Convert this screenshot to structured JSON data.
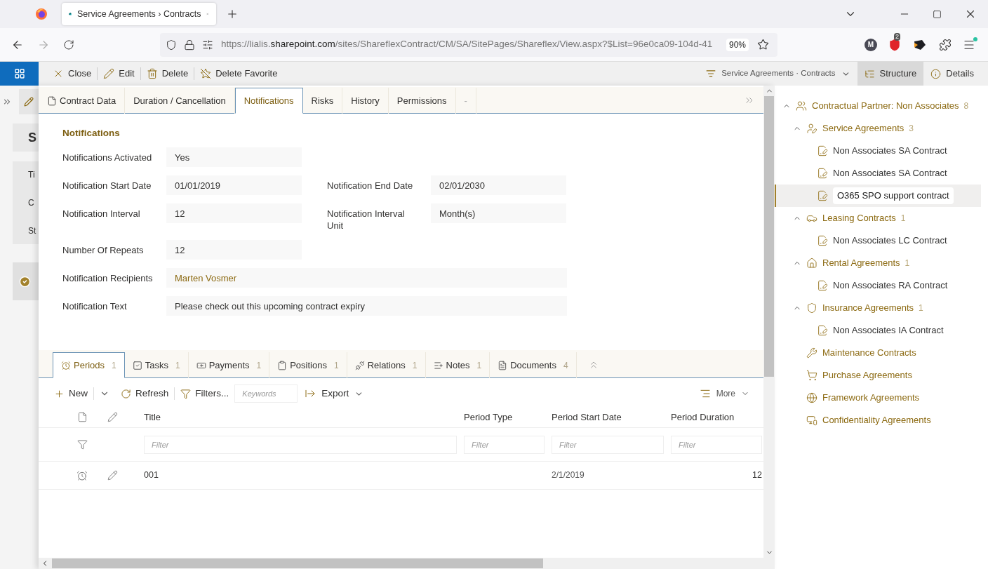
{
  "browser": {
    "tab_title": "Service Agreements › Contracts",
    "url_start": "https://lialis.",
    "url_domain": "sharepoint.com",
    "url_rest": "/sites/ShareflexContract/CM/SA/SitePages/Shareflex/View.aspx?$List=96e0ca09-104d-41",
    "zoom": "90%",
    "profile_initial": "M",
    "blocker_count": "2"
  },
  "background_page": {
    "title": "S",
    "fields": [
      "Ti",
      "C",
      "St"
    ]
  },
  "commands": [
    {
      "label": "Close",
      "kind": "close"
    },
    {
      "label": "Edit",
      "kind": "edit"
    },
    {
      "label": "Delete",
      "kind": "delete"
    },
    {
      "label": "Delete Favorite",
      "kind": "unfavorite"
    }
  ],
  "view_selector": "Service Agreements · Contracts",
  "panes": [
    {
      "label": "Structure",
      "kind": "structure",
      "selected": true
    },
    {
      "label": "Details",
      "kind": "info",
      "selected": false
    }
  ],
  "tabs": [
    {
      "label": "Contract Data",
      "kind": "document",
      "selected": false
    },
    {
      "label": "Duration / Cancellation",
      "selected": false
    },
    {
      "label": "Notifications",
      "selected": true
    },
    {
      "label": "Risks",
      "selected": false
    },
    {
      "label": "History",
      "selected": false
    },
    {
      "label": "Permissions",
      "selected": false
    },
    {
      "label": "-",
      "selected": false
    }
  ],
  "section": {
    "title": "Notifications",
    "rows": [
      {
        "fields": [
          {
            "label": "Notifications Activated",
            "value": "Yes",
            "kind": "text"
          }
        ]
      },
      {
        "fields": [
          {
            "label": "Notification Start Date",
            "value": "01/01/2019",
            "kind": "text"
          },
          {
            "label": "Notification End Date",
            "value": "02/01/2030",
            "kind": "text"
          }
        ]
      },
      {
        "fields": [
          {
            "label": "Notification Interval",
            "value": "12",
            "kind": "text"
          },
          {
            "label": "Notification Interval Unit",
            "value": "Month(s)",
            "kind": "text"
          }
        ]
      },
      {
        "fields": [
          {
            "label": "Number Of Repeats",
            "value": "12",
            "kind": "text"
          }
        ]
      },
      {
        "fields": [
          {
            "label": "Notification Recipients",
            "value": "Marten Vosmer",
            "kind": "person"
          }
        ]
      },
      {
        "fields": [
          {
            "label": "Notification Text",
            "value": "Please check out this upcoming contract expiry",
            "kind": "long"
          }
        ]
      }
    ]
  },
  "subtabs": [
    {
      "label": "Periods",
      "count": "1",
      "kind": "alarm",
      "selected": true
    },
    {
      "label": "Tasks",
      "count": "1",
      "kind": "task",
      "selected": false
    },
    {
      "label": "Payments",
      "count": "1",
      "kind": "money",
      "selected": false
    },
    {
      "label": "Positions",
      "count": "1",
      "kind": "clipboard",
      "selected": false
    },
    {
      "label": "Relations",
      "count": "1",
      "kind": "plug",
      "selected": false
    },
    {
      "label": "Notes",
      "count": "1",
      "kind": "notes",
      "selected": false
    },
    {
      "label": "Documents",
      "count": "4",
      "kind": "document",
      "selected": false
    }
  ],
  "toolbar": {
    "new": "New",
    "refresh": "Refresh",
    "filters": "Filters...",
    "keywords_placeholder": "Keywords",
    "export": "Export",
    "more": "More"
  },
  "table": {
    "columns": [
      "Title",
      "Period Type",
      "Period Start Date",
      "Period Duration"
    ],
    "filter_placeholders": [
      "Filter",
      "Filter",
      "Filter",
      "Filter"
    ],
    "rows": [
      {
        "title": "001",
        "period_start_date": "2/1/2019",
        "period_duration": "12"
      }
    ]
  },
  "tree": [
    {
      "label": "Contractual Partner: Non Associates",
      "count": "8",
      "kind": "people",
      "expanded": true,
      "selected": false,
      "children": [
        {
          "label": "Service Agreements",
          "count": "3",
          "kind": "person-edit",
          "expanded": true,
          "selected": false,
          "children": [
            {
              "label": "Non Associates SA Contract",
              "kind": "contract",
              "selected": false
            },
            {
              "label": "Non Associates SA Contract",
              "kind": "contract",
              "selected": false
            },
            {
              "label": "O365 SPO support contract",
              "kind": "contract",
              "selected": true
            }
          ]
        },
        {
          "label": "Leasing Contracts",
          "count": "1",
          "kind": "car",
          "expanded": true,
          "selected": false,
          "children": [
            {
              "label": "Non Associates LC Contract",
              "kind": "contract",
              "selected": false
            }
          ]
        },
        {
          "label": "Rental Agreements",
          "count": "1",
          "kind": "home",
          "expanded": true,
          "selected": false,
          "children": [
            {
              "label": "Non Associates RA Contract",
              "kind": "contract",
              "selected": false
            }
          ]
        },
        {
          "label": "Insurance Agreements",
          "count": "1",
          "kind": "shield",
          "expanded": true,
          "selected": false,
          "children": [
            {
              "label": "Non Associates IA Contract",
              "kind": "contract",
              "selected": false
            }
          ]
        },
        {
          "label": "Maintenance Contracts",
          "kind": "tools",
          "selected": false
        },
        {
          "label": "Purchase Agreements",
          "kind": "cart",
          "selected": false
        },
        {
          "label": "Framework Agreements",
          "kind": "globe",
          "selected": false
        },
        {
          "label": "Confidentiality Agreements",
          "kind": "monitor",
          "selected": false
        }
      ]
    }
  ]
}
